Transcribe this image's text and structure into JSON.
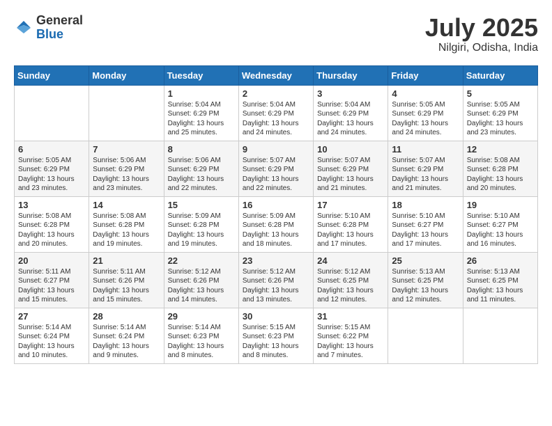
{
  "header": {
    "logo_general": "General",
    "logo_blue": "Blue",
    "month_year": "July 2025",
    "location": "Nilgiri, Odisha, India"
  },
  "days_of_week": [
    "Sunday",
    "Monday",
    "Tuesday",
    "Wednesday",
    "Thursday",
    "Friday",
    "Saturday"
  ],
  "weeks": [
    [
      {
        "day": "",
        "info": ""
      },
      {
        "day": "",
        "info": ""
      },
      {
        "day": "1",
        "info": "Sunrise: 5:04 AM\nSunset: 6:29 PM\nDaylight: 13 hours and 25 minutes."
      },
      {
        "day": "2",
        "info": "Sunrise: 5:04 AM\nSunset: 6:29 PM\nDaylight: 13 hours and 24 minutes."
      },
      {
        "day": "3",
        "info": "Sunrise: 5:04 AM\nSunset: 6:29 PM\nDaylight: 13 hours and 24 minutes."
      },
      {
        "day": "4",
        "info": "Sunrise: 5:05 AM\nSunset: 6:29 PM\nDaylight: 13 hours and 24 minutes."
      },
      {
        "day": "5",
        "info": "Sunrise: 5:05 AM\nSunset: 6:29 PM\nDaylight: 13 hours and 23 minutes."
      }
    ],
    [
      {
        "day": "6",
        "info": "Sunrise: 5:05 AM\nSunset: 6:29 PM\nDaylight: 13 hours and 23 minutes."
      },
      {
        "day": "7",
        "info": "Sunrise: 5:06 AM\nSunset: 6:29 PM\nDaylight: 13 hours and 23 minutes."
      },
      {
        "day": "8",
        "info": "Sunrise: 5:06 AM\nSunset: 6:29 PM\nDaylight: 13 hours and 22 minutes."
      },
      {
        "day": "9",
        "info": "Sunrise: 5:07 AM\nSunset: 6:29 PM\nDaylight: 13 hours and 22 minutes."
      },
      {
        "day": "10",
        "info": "Sunrise: 5:07 AM\nSunset: 6:29 PM\nDaylight: 13 hours and 21 minutes."
      },
      {
        "day": "11",
        "info": "Sunrise: 5:07 AM\nSunset: 6:29 PM\nDaylight: 13 hours and 21 minutes."
      },
      {
        "day": "12",
        "info": "Sunrise: 5:08 AM\nSunset: 6:28 PM\nDaylight: 13 hours and 20 minutes."
      }
    ],
    [
      {
        "day": "13",
        "info": "Sunrise: 5:08 AM\nSunset: 6:28 PM\nDaylight: 13 hours and 20 minutes."
      },
      {
        "day": "14",
        "info": "Sunrise: 5:08 AM\nSunset: 6:28 PM\nDaylight: 13 hours and 19 minutes."
      },
      {
        "day": "15",
        "info": "Sunrise: 5:09 AM\nSunset: 6:28 PM\nDaylight: 13 hours and 19 minutes."
      },
      {
        "day": "16",
        "info": "Sunrise: 5:09 AM\nSunset: 6:28 PM\nDaylight: 13 hours and 18 minutes."
      },
      {
        "day": "17",
        "info": "Sunrise: 5:10 AM\nSunset: 6:28 PM\nDaylight: 13 hours and 17 minutes."
      },
      {
        "day": "18",
        "info": "Sunrise: 5:10 AM\nSunset: 6:27 PM\nDaylight: 13 hours and 17 minutes."
      },
      {
        "day": "19",
        "info": "Sunrise: 5:10 AM\nSunset: 6:27 PM\nDaylight: 13 hours and 16 minutes."
      }
    ],
    [
      {
        "day": "20",
        "info": "Sunrise: 5:11 AM\nSunset: 6:27 PM\nDaylight: 13 hours and 15 minutes."
      },
      {
        "day": "21",
        "info": "Sunrise: 5:11 AM\nSunset: 6:26 PM\nDaylight: 13 hours and 15 minutes."
      },
      {
        "day": "22",
        "info": "Sunrise: 5:12 AM\nSunset: 6:26 PM\nDaylight: 13 hours and 14 minutes."
      },
      {
        "day": "23",
        "info": "Sunrise: 5:12 AM\nSunset: 6:26 PM\nDaylight: 13 hours and 13 minutes."
      },
      {
        "day": "24",
        "info": "Sunrise: 5:12 AM\nSunset: 6:25 PM\nDaylight: 13 hours and 12 minutes."
      },
      {
        "day": "25",
        "info": "Sunrise: 5:13 AM\nSunset: 6:25 PM\nDaylight: 13 hours and 12 minutes."
      },
      {
        "day": "26",
        "info": "Sunrise: 5:13 AM\nSunset: 6:25 PM\nDaylight: 13 hours and 11 minutes."
      }
    ],
    [
      {
        "day": "27",
        "info": "Sunrise: 5:14 AM\nSunset: 6:24 PM\nDaylight: 13 hours and 10 minutes."
      },
      {
        "day": "28",
        "info": "Sunrise: 5:14 AM\nSunset: 6:24 PM\nDaylight: 13 hours and 9 minutes."
      },
      {
        "day": "29",
        "info": "Sunrise: 5:14 AM\nSunset: 6:23 PM\nDaylight: 13 hours and 8 minutes."
      },
      {
        "day": "30",
        "info": "Sunrise: 5:15 AM\nSunset: 6:23 PM\nDaylight: 13 hours and 8 minutes."
      },
      {
        "day": "31",
        "info": "Sunrise: 5:15 AM\nSunset: 6:22 PM\nDaylight: 13 hours and 7 minutes."
      },
      {
        "day": "",
        "info": ""
      },
      {
        "day": "",
        "info": ""
      }
    ]
  ]
}
